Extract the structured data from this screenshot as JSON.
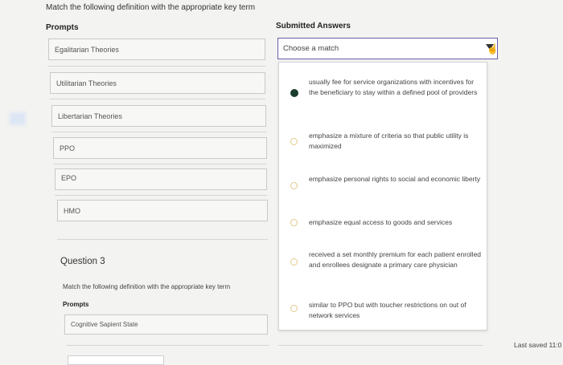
{
  "question": {
    "instruction": "Match the following definition with the appropriate key term",
    "prompts_header": "Prompts",
    "answers_header": "Submitted Answers",
    "prompts": [
      {
        "label": "Egalitarian Theories"
      },
      {
        "label": "Utilitarian Theories"
      },
      {
        "label": "Libertarian Theories"
      },
      {
        "label": "PPO"
      },
      {
        "label": "EPO"
      },
      {
        "label": "HMO"
      }
    ],
    "select": {
      "value": "Choose a match"
    },
    "options": [
      {
        "text": "usually fee for service organizations with incentives for the beneficiary to stay within a defined pool of providers",
        "selected": true
      },
      {
        "text": "emphasize a mixture of criteria so that public utility is maximized",
        "selected": false
      },
      {
        "text": "emphasize personal rights to social and economic liberty",
        "selected": false
      },
      {
        "text": "emphasize equal access to goods and services",
        "selected": false
      },
      {
        "text": "received a set monthly premium for each patient enrolled and enrollees designate a primary care physician",
        "selected": false
      },
      {
        "text": "similar to PPO but with toucher restrictions on out of network services",
        "selected": false
      }
    ]
  },
  "question3": {
    "title": "Question 3",
    "instruction": "Match the following definition with the appropriate key term",
    "prompts_header": "Prompts",
    "prompts": [
      {
        "label": "Cognitive Sapient State"
      }
    ]
  },
  "footer": {
    "last_saved": "Last saved 11:0"
  },
  "colors": {
    "selected_radio": "#1a3d2c",
    "select_border": "#6b5aa8"
  }
}
